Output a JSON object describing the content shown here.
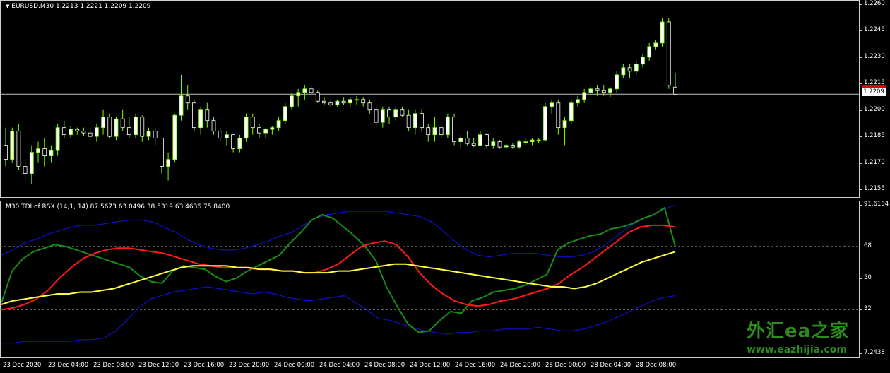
{
  "main_chart": {
    "header": "EURUSD,M30  1.2213 1.2221 1.2209 1.2209",
    "current_price": "1.2209",
    "price_labels": [
      "1.2260",
      "1.2245",
      "1.2230",
      "1.2215",
      "1.2200",
      "1.2185",
      "1.2170",
      "1.2155"
    ],
    "colors": {
      "bull": "#ffffff",
      "bear": "#ffffff",
      "wick": "#7CFC00",
      "bid_line": "#ff2020",
      "ask_line": "#c0c0c0"
    }
  },
  "indicator": {
    "header": "M30 TDI of RSX  (14,1, 14) 87.5673 63.0496 38.5319 63.4636 75.8400",
    "levels": [
      "91.6184",
      "68",
      "50",
      "32",
      "7.2438"
    ],
    "colors": {
      "upper_band": "#1010c8",
      "lower_band": "#1010c8",
      "price_line": "#1a8c1a",
      "signal_line": "#ff1a1a",
      "market_base": "#ffff40"
    }
  },
  "time_axis": [
    "23 Dec 2020",
    "23 Dec 04:00",
    "23 Dec 08:00",
    "23 Dec 12:00",
    "23 Dec 16:00",
    "23 Dec 20:00",
    "24 Dec 00:00",
    "24 Dec 04:00",
    "24 Dec 08:00",
    "24 Dec 12:00",
    "24 Dec 16:00",
    "24 Dec 20:00",
    "28 Dec 00:00",
    "28 Dec 04:00",
    "28 Dec 08:00"
  ],
  "watermark": {
    "title": "外汇ea之家",
    "url": "www.eazhijia.com"
  },
  "chart_data": [
    {
      "type": "candlestick",
      "title": "EURUSD,M30",
      "ylim": [
        2148,
        2262
      ],
      "y_unit": "1.2xxx (last four digits x 10000)",
      "ohlc": [
        [
          2180,
          2190,
          2168,
          2172
        ],
        [
          2172,
          2190,
          2170,
          2188
        ],
        [
          2188,
          2192,
          2166,
          2168
        ],
        [
          2168,
          2172,
          2160,
          2164
        ],
        [
          2164,
          2180,
          2158,
          2176
        ],
        [
          2176,
          2182,
          2170,
          2178
        ],
        [
          2178,
          2184,
          2168,
          2174
        ],
        [
          2174,
          2180,
          2170,
          2177
        ],
        [
          2177,
          2192,
          2174,
          2190
        ],
        [
          2190,
          2194,
          2184,
          2186
        ],
        [
          2186,
          2191,
          2184,
          2189
        ],
        [
          2189,
          2190,
          2186,
          2188
        ],
        [
          2188,
          2190,
          2185,
          2187
        ],
        [
          2187,
          2190,
          2183,
          2185
        ],
        [
          2185,
          2192,
          2182,
          2190
        ],
        [
          2190,
          2200,
          2186,
          2196
        ],
        [
          2196,
          2198,
          2184,
          2185
        ],
        [
          2185,
          2196,
          2183,
          2195
        ],
        [
          2195,
          2200,
          2188,
          2190
        ],
        [
          2190,
          2196,
          2184,
          2186
        ],
        [
          2186,
          2198,
          2184,
          2196
        ],
        [
          2196,
          2197,
          2182,
          2185
        ],
        [
          2185,
          2190,
          2183,
          2188
        ],
        [
          2188,
          2190,
          2180,
          2184
        ],
        [
          2184,
          2184,
          2164,
          2168
        ],
        [
          2168,
          2176,
          2160,
          2172
        ],
        [
          2172,
          2198,
          2170,
          2197
        ],
        [
          2197,
          2220,
          2194,
          2208
        ],
        [
          2208,
          2214,
          2200,
          2204
        ],
        [
          2204,
          2206,
          2188,
          2190
        ],
        [
          2190,
          2202,
          2186,
          2200
        ],
        [
          2200,
          2204,
          2190,
          2194
        ],
        [
          2194,
          2196,
          2186,
          2188
        ],
        [
          2188,
          2190,
          2182,
          2184
        ],
        [
          2184,
          2188,
          2180,
          2186
        ],
        [
          2186,
          2186,
          2176,
          2178
        ],
        [
          2178,
          2186,
          2176,
          2184
        ],
        [
          2184,
          2198,
          2182,
          2196
        ],
        [
          2196,
          2198,
          2186,
          2190
        ],
        [
          2190,
          2192,
          2184,
          2187
        ],
        [
          2187,
          2190,
          2184,
          2189
        ],
        [
          2189,
          2191,
          2186,
          2190
        ],
        [
          2190,
          2196,
          2188,
          2194
        ],
        [
          2194,
          2204,
          2192,
          2202
        ],
        [
          2202,
          2210,
          2200,
          2208
        ],
        [
          2208,
          2212,
          2202,
          2210
        ],
        [
          2210,
          2214,
          2206,
          2212
        ],
        [
          2212,
          2214,
          2206,
          2210
        ],
        [
          2210,
          2211,
          2204,
          2205
        ],
        [
          2205,
          2207,
          2203,
          2204
        ],
        [
          2204,
          2206,
          2202,
          2203
        ],
        [
          2203,
          2206,
          2202,
          2205
        ],
        [
          2205,
          2207,
          2203,
          2204
        ],
        [
          2204,
          2207,
          2202,
          2206
        ],
        [
          2206,
          2208,
          2203,
          2206
        ],
        [
          2206,
          2207,
          2202,
          2204
        ],
        [
          2204,
          2206,
          2198,
          2200
        ],
        [
          2200,
          2202,
          2190,
          2193
        ],
        [
          2193,
          2202,
          2190,
          2200
        ],
        [
          2200,
          2202,
          2192,
          2196
        ],
        [
          2196,
          2202,
          2194,
          2200
        ],
        [
          2200,
          2202,
          2196,
          2197
        ],
        [
          2197,
          2200,
          2188,
          2190
        ],
        [
          2190,
          2200,
          2186,
          2198
        ],
        [
          2198,
          2200,
          2188,
          2190
        ],
        [
          2190,
          2192,
          2182,
          2186
        ],
        [
          2186,
          2196,
          2182,
          2190
        ],
        [
          2190,
          2192,
          2184,
          2186
        ],
        [
          2186,
          2198,
          2184,
          2196
        ],
        [
          2196,
          2198,
          2180,
          2182
        ],
        [
          2182,
          2186,
          2178,
          2184
        ],
        [
          2184,
          2188,
          2180,
          2181
        ],
        [
          2181,
          2184,
          2179,
          2180
        ],
        [
          2180,
          2188,
          2180,
          2186
        ],
        [
          2186,
          2187,
          2178,
          2180
        ],
        [
          2180,
          2184,
          2178,
          2182
        ],
        [
          2182,
          2183,
          2178,
          2179
        ],
        [
          2179,
          2181,
          2178,
          2180
        ],
        [
          2180,
          2181,
          2178,
          2179
        ],
        [
          2179,
          2183,
          2178,
          2182
        ],
        [
          2182,
          2184,
          2180,
          2182
        ],
        [
          2182,
          2184,
          2180,
          2183
        ],
        [
          2183,
          2184,
          2181,
          2183
        ],
        [
          2183,
          2204,
          2182,
          2202
        ],
        [
          2202,
          2206,
          2198,
          2204
        ],
        [
          2204,
          2206,
          2186,
          2190
        ],
        [
          2190,
          2196,
          2180,
          2194
        ],
        [
          2194,
          2206,
          2192,
          2204
        ],
        [
          2204,
          2208,
          2202,
          2206
        ],
        [
          2206,
          2212,
          2204,
          2210
        ],
        [
          2210,
          2214,
          2208,
          2212
        ],
        [
          2212,
          2214,
          2208,
          2211
        ],
        [
          2211,
          2214,
          2208,
          2210
        ],
        [
          2210,
          2213,
          2207,
          2212
        ],
        [
          2212,
          2222,
          2210,
          2220
        ],
        [
          2220,
          2226,
          2218,
          2224
        ],
        [
          2224,
          2226,
          2218,
          2222
        ],
        [
          2222,
          2228,
          2220,
          2226
        ],
        [
          2226,
          2232,
          2224,
          2230
        ],
        [
          2230,
          2238,
          2228,
          2236
        ],
        [
          2236,
          2240,
          2234,
          2238
        ],
        [
          2238,
          2252,
          2236,
          2250
        ],
        [
          2250,
          2252,
          2212,
          2214
        ],
        [
          2213,
          2221,
          2209,
          2209
        ]
      ],
      "bid": 1.2209,
      "ask": 1.2213
    },
    {
      "type": "line",
      "title": "M30 TDI of RSX  (14,1, 14)",
      "ylim": [
        7.2438,
        91.6184
      ],
      "levels": [
        68,
        50,
        32
      ],
      "series": [
        {
          "values": [
            63,
            66,
            70,
            72,
            75,
            77,
            79,
            80,
            80,
            81,
            82,
            83,
            83,
            82,
            79,
            76,
            72,
            69,
            67,
            66,
            66,
            67,
            69,
            71,
            74,
            76,
            80,
            84,
            86,
            87,
            88,
            88,
            88,
            88,
            87,
            86,
            85,
            82,
            77,
            71,
            66,
            63,
            62,
            63,
            64,
            64,
            64,
            63,
            62,
            62,
            63,
            65,
            69,
            74,
            79,
            83,
            86,
            89,
            91.6
          ]
        },
        {
          "values": [
            13,
            13,
            14,
            14,
            14,
            14,
            14,
            15,
            15,
            16,
            20,
            26,
            33,
            38,
            40,
            42,
            43,
            44,
            45,
            44,
            43,
            42,
            41,
            42,
            41,
            39,
            38,
            37,
            38,
            39,
            40,
            36,
            32,
            27,
            26,
            24,
            22,
            20,
            19,
            18,
            19,
            19,
            20,
            20,
            21,
            21,
            21,
            22,
            21,
            20,
            20,
            21,
            23,
            25,
            28,
            31,
            34,
            37,
            39,
            40
          ]
        },
        {
          "values": [
            36,
            54,
            61,
            65,
            67,
            69,
            68,
            66,
            64,
            62,
            60,
            58,
            56,
            51,
            48,
            47,
            54,
            57,
            56,
            55,
            51,
            48,
            50,
            54,
            57,
            60,
            63,
            70,
            76,
            83,
            86,
            84,
            79,
            74,
            68,
            60,
            45,
            34,
            24,
            19,
            20,
            26,
            31,
            30,
            37,
            39,
            42,
            43,
            44,
            46,
            49,
            52,
            66,
            70,
            72,
            74,
            75,
            78,
            79,
            81,
            84,
            86,
            90,
            68
          ]
        },
        {
          "values": [
            32,
            33,
            35,
            38,
            43,
            50,
            56,
            61,
            64,
            66,
            67,
            67,
            66,
            65,
            64,
            62,
            60,
            58,
            57,
            56,
            56,
            56,
            55,
            55,
            54,
            54,
            53,
            53,
            55,
            58,
            63,
            68,
            70,
            71,
            69,
            62,
            53,
            46,
            41,
            37,
            35,
            34,
            35,
            37,
            38,
            40,
            42,
            44,
            47,
            52,
            56,
            61,
            66,
            71,
            76,
            79,
            80,
            80,
            79
          ]
        },
        {
          "values": [
            35,
            37,
            38,
            39,
            40,
            41,
            41,
            42,
            42,
            43,
            44,
            46,
            48,
            50,
            52,
            54,
            56,
            57,
            57,
            57,
            57,
            56,
            56,
            55,
            55,
            54,
            54,
            53,
            53,
            53,
            54,
            54,
            55,
            56,
            57,
            58,
            58,
            57,
            56,
            55,
            54,
            53,
            52,
            51,
            50,
            49,
            48,
            47,
            46,
            45,
            45,
            44,
            45,
            47,
            50,
            53,
            56,
            59,
            61,
            63,
            65
          ]
        }
      ]
    }
  ]
}
